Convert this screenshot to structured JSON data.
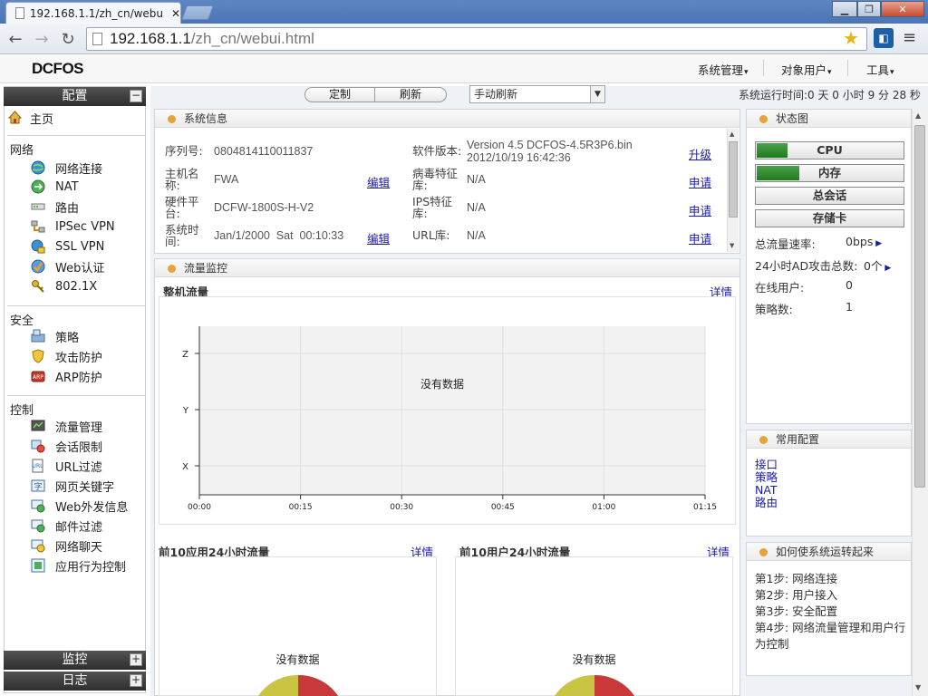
{
  "browser": {
    "tab_title": "192.168.1.1/zh_cn/webui.html",
    "url_host": "192.168.1.1",
    "url_path": "/zh_cn/webui.html"
  },
  "header": {
    "logo": "DCFOS",
    "menus": [
      "系统管理",
      "对象用户",
      "工具"
    ]
  },
  "sidebar": {
    "config_title": "配置",
    "home": "主页",
    "groups": [
      {
        "title": "网络",
        "items": [
          "网络连接",
          "NAT",
          "路由",
          "IPSec VPN",
          "SSL VPN",
          "Web认证",
          "802.1X"
        ]
      },
      {
        "title": "安全",
        "items": [
          "策略",
          "攻击防护",
          "ARP防护"
        ]
      },
      {
        "title": "控制",
        "items": [
          "流量管理",
          "会话限制",
          "URL过滤",
          "网页关键字",
          "Web外发信息",
          "邮件过滤",
          "网络聊天",
          "应用行为控制"
        ]
      }
    ],
    "monitor_title": "监控",
    "log_title": "日志"
  },
  "toolbar": {
    "custom": "定制",
    "refresh": "刷新",
    "refresh_mode": "手动刷新",
    "uptime": "系统运行时间:0 天 0 小时 9 分 28 秒"
  },
  "sysinfo": {
    "title": "系统信息",
    "serial_label": "序列号:",
    "serial": "0804814110011837",
    "hostname_label": "主机名称:",
    "hostname": "FWA",
    "hw_label": "硬件平台:",
    "hw": "DCFW-1800S-H-V2",
    "time_label": "系统时间:",
    "time": "Jan/1/2000  Sat  00:10:33",
    "edit": "编辑",
    "sw_label": "软件版本:",
    "sw": "Version 4.5 DCFOS-4.5R3P6.bin 2012/10/19 16:42:36",
    "upgrade": "升级",
    "virus_label": "病毒特征库:",
    "virus": "N/A",
    "ips_label": "IPS特征库:",
    "ips": "N/A",
    "url_label": "URL库:",
    "url": "N/A",
    "apply": "申请"
  },
  "traffic": {
    "title": "流量监控",
    "whole_title": "整机流量",
    "details": "详情",
    "no_data": "没有数据",
    "top_app_title": "前10应用24小时流量",
    "top_user_title": "前10用户24小时流量"
  },
  "chart_data": {
    "type": "line",
    "title": "整机流量",
    "x_ticks": [
      "00:00",
      "00:15",
      "00:30",
      "00:45",
      "01:00",
      "01:15"
    ],
    "y_ticks": [
      "X",
      "Y",
      "Z"
    ],
    "series": [],
    "annotation": "没有数据",
    "grid": true
  },
  "status": {
    "title": "状态图",
    "bars": [
      {
        "label": "CPU",
        "fill": 0.21
      },
      {
        "label": "内存",
        "fill": 0.29
      },
      {
        "label": "总会话",
        "fill": 0
      },
      {
        "label": "存储卡",
        "fill": 0
      }
    ],
    "total_rate_label": "总流量速率:",
    "total_rate": "0bps",
    "ad_label": "24小时AD攻击总数:",
    "ad": "0个",
    "online_label": "在线用户:",
    "online": "0",
    "policy_label": "策略数:",
    "policy": "1"
  },
  "common": {
    "title": "常用配置",
    "links": [
      "接口",
      "策略",
      "NAT",
      "路由"
    ]
  },
  "howto": {
    "title": "如何使系统运转起来",
    "steps": [
      "第1步: 网络连接",
      "第2步: 用户接入",
      "第3步: 安全配置",
      "第4步: 网络流量管理和用户行为控制"
    ]
  }
}
